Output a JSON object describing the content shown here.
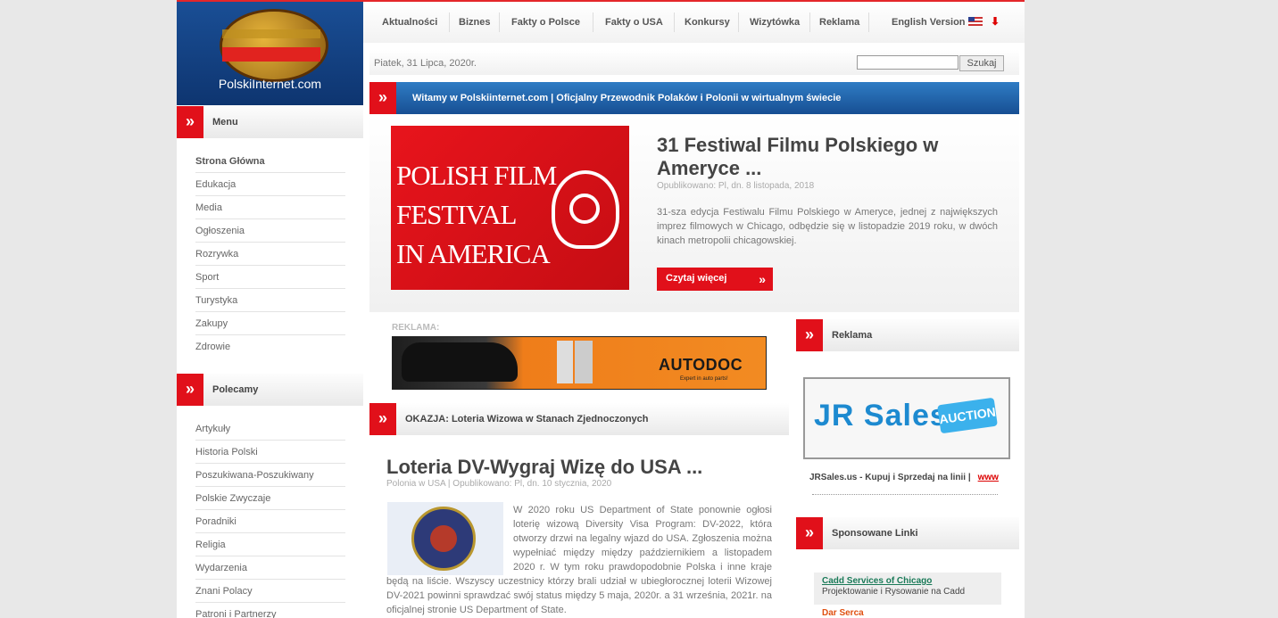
{
  "logo": {
    "text": "PolskiInternet.com"
  },
  "nav": {
    "items": [
      "Aktualności",
      "Biznes",
      "Fakty o Polsce",
      "Fakty o USA",
      "Konkursy",
      "Wizytówka",
      "Reklama"
    ],
    "english": "English Version"
  },
  "datebar": {
    "date": "Piatek, 31 Lipca, 2020r.",
    "search_button": "Szukaj",
    "search_value": ""
  },
  "welcome": {
    "text": "Witamy w Polskiinternet.com | Oficjalny Przewodnik Polaków i Polonii w wirtualnym świecie"
  },
  "menu": {
    "title": "Menu",
    "items": [
      "Strona Główna",
      "Edukacja",
      "Media",
      "Ogłoszenia",
      "Rozrywka",
      "Sport",
      "Turystyka",
      "Zakupy",
      "Zdrowie"
    ]
  },
  "polecamy": {
    "title": "Polecamy",
    "items": [
      "Artykuły",
      "Historia Polski",
      "Poszukiwana-Poszukiwany",
      "Polskie Zwyczaje",
      "Poradniki",
      "Religia",
      "Wydarzenia",
      "Znani Polacy",
      "Patroni i Partnerzy"
    ]
  },
  "feature": {
    "image_text": [
      "POLISH FILM",
      "FESTIVAL",
      "IN AMERICA"
    ],
    "title": "31 Festiwal Filmu Polskiego w Ameryce ...",
    "meta": "Opublikowano: Pl, dn. 8 listopada, 2018",
    "desc": "31-sza edycja Festiwalu Filmu Polskiego w Ameryce, jednej z największych imprez filmowych w Chicago, odbędzie się w listopadzie 2019 roku, w dwóch kinach metropolii chicagowskiej.",
    "more": "Czytaj więcej"
  },
  "ad": {
    "label": "REKLAMA:",
    "brand": "AUTODOC",
    "sub": "Expert in auto parts!"
  },
  "okazja": {
    "title": "OKAZJA: Loteria Wizowa w Stanach Zjednoczonych"
  },
  "article": {
    "title": "Loteria DV-Wygraj Wizę do USA ...",
    "meta": "Polonia w USA | Opublikowano: Pl, dn. 10 stycznia, 2020",
    "body": "W 2020 roku US Department of State ponownie ogłosi loterię wizową Diversity Visa Program: DV-2022, która otworzy drzwi na legalny wjazd do USA. Zgłoszenia można wypełniać między między  październikiem a listopadem 2020 r. W tym roku prawdopodobnie Polska i inne kraje będą na liście. Wszyscy uczestnicy którzy brali udział w ubiegłorocznej loterii Wizowej DV-2021 powinni sprawdzać swój status między 5 maja, 2020r. a 31 września, 2021r. na oficjalnej stronie US Department of State."
  },
  "reklama": {
    "title": "Reklama",
    "jr_main": "JR Sales",
    "jr_badge": "AUCTION",
    "link_text": "JRSales.us - Kupuj i Sprzedaj na linii  |",
    "www": "www"
  },
  "sponsowane": {
    "title": "Sponsowane Linki",
    "link1": "Cadd Services of Chicago",
    "link1_desc": "Projektowanie i Rysowanie na Cadd",
    "link2": "Dar Serca"
  },
  "colors": {
    "accent": "#e1101a",
    "blue": "#1f5fa8"
  }
}
